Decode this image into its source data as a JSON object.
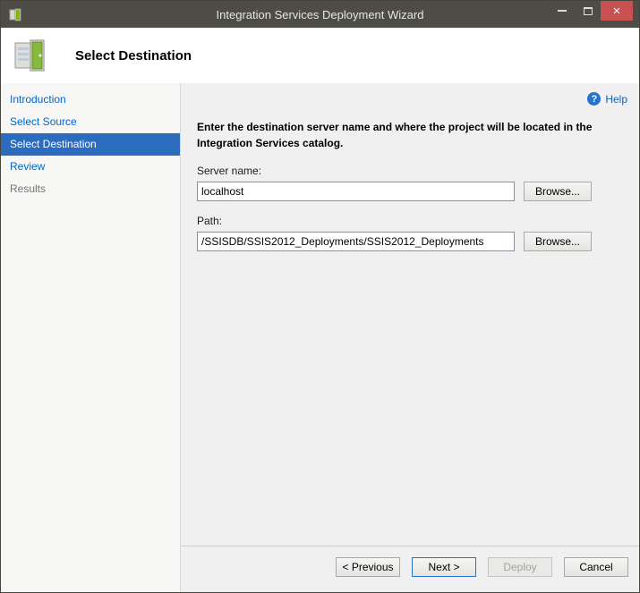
{
  "window": {
    "title": "Integration Services Deployment Wizard",
    "controls": {
      "close_glyph": "×"
    }
  },
  "header": {
    "title": "Select Destination"
  },
  "sidebar": {
    "items": [
      {
        "label": "Introduction",
        "state": "link"
      },
      {
        "label": "Select Source",
        "state": "link"
      },
      {
        "label": "Select Destination",
        "state": "active"
      },
      {
        "label": "Review",
        "state": "link"
      },
      {
        "label": "Results",
        "state": "disabled"
      }
    ]
  },
  "main": {
    "help_icon_glyph": "?",
    "help_label": "Help",
    "instruction": "Enter the destination server name and where the project will be located in the Integration Services catalog.",
    "fields": {
      "server": {
        "label": "Server name:",
        "value": "localhost",
        "browse": "Browse..."
      },
      "path": {
        "label": "Path:",
        "value": "/SSISDB/SSIS2012_Deployments/SSIS2012_Deployments",
        "browse": "Browse..."
      }
    }
  },
  "footer": {
    "previous": "< Previous",
    "next": "Next >",
    "deploy": "Deploy",
    "cancel": "Cancel"
  },
  "colors": {
    "titlebar": "#4d4d45",
    "close_button": "#c75050",
    "active_nav": "#2b6cbf",
    "link": "#0066cc",
    "help_icon": "#2573cf",
    "content_bg": "#f0f0f0",
    "header_bg": "#ffffff"
  }
}
